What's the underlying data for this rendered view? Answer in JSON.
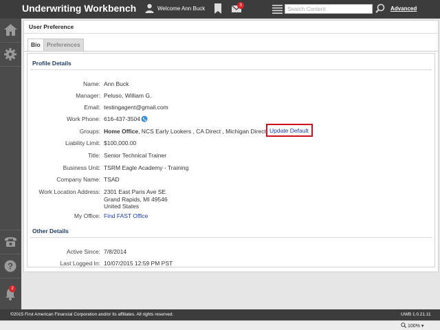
{
  "header": {
    "app_title": "Underwriting Workbench",
    "welcome": "Welcome Ann Buck",
    "mail_count": "3",
    "search_placeholder": "Search Content",
    "advanced_label": "Advanced"
  },
  "sidebar": {
    "notification_count": "2"
  },
  "page": {
    "title": "User Preference",
    "tabs": [
      {
        "label": "Bio",
        "active": true
      },
      {
        "label": "Preferences",
        "active": false
      }
    ]
  },
  "profile": {
    "section_title": "Profile Details",
    "name_label": "Name:",
    "name": "Ann Buck",
    "manager_label": "Manager:",
    "manager": "Peluso, William G.",
    "email_label": "Email:",
    "email": "testingagent@gmail.com",
    "phone_label": "Work Phone:",
    "phone": "616-437-3504",
    "groups_label": "Groups:",
    "groups_default": "Home Office",
    "groups_rest": ", NCS Early Lookers , CA Direct , Michigan Direct",
    "update_default": "Update Default",
    "liability_label": "Liability Limit:",
    "liability": "$100,000.00",
    "title_label": "Title:",
    "title": "Senior Technical Trainer",
    "business_unit_label": "Business Unit:",
    "business_unit": "TSRM Eagle Academy - Training",
    "company_label": "Company Name:",
    "company": "TSAD",
    "address_label": "Work Location Address:",
    "address_line1": "2301 East Paris Ave SE",
    "address_line2": "Grand Rapids, MI 49546",
    "address_line3": "United States",
    "office_label": "My Office:",
    "office_link": "Find FAST Office"
  },
  "other": {
    "section_title": "Other Details",
    "active_since_label": "Active Since:",
    "active_since": "7/8/2014",
    "last_login_label": "Last Logged In:",
    "last_login": "10/07/2015 12:59 PM PST"
  },
  "footer": {
    "copyright": "©2015 First American Financial Corporation and/or its affiliates. All rights reserved.",
    "version": "UWB 1.0.21.11"
  },
  "statusbar": {
    "zoom": "100%"
  }
}
